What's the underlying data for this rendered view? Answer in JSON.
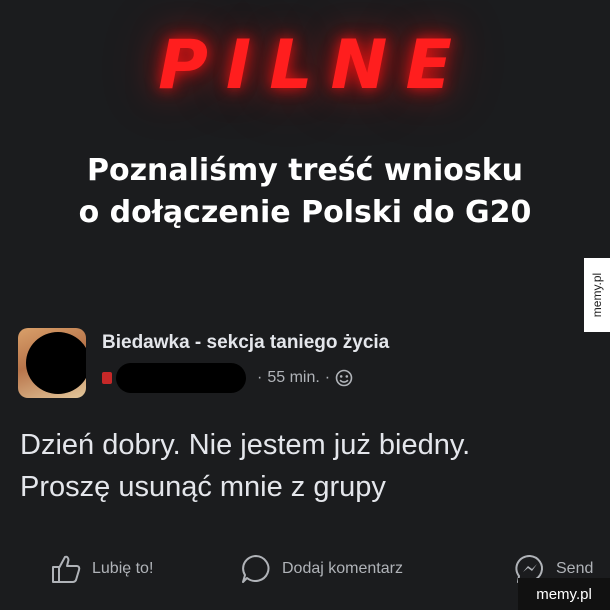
{
  "meme": {
    "headline": "PILNE",
    "subhead_lines": [
      "Poznaliśmy treść wniosku",
      "o dołączenie Polski do G20"
    ]
  },
  "post": {
    "group_name": "Biedawka - sekcja taniego życia",
    "time": "55 min.",
    "meta_icon": "globe-icon",
    "message_lines": [
      "Dzień dobry. Nie jestem już biedny.",
      "Proszę usunąć mnie z grupy"
    ]
  },
  "actions": {
    "like_label": "Lubię to!",
    "comment_label": "Dodaj komentarz",
    "send_label": "Send"
  },
  "watermarks": {
    "side": "memy.pl",
    "corner": "memy.pl"
  },
  "colors": {
    "headline_red": "#ff1e1e",
    "background": "#1b1c1e",
    "text_primary": "#e4e6eb",
    "text_secondary": "#b0b3b8"
  }
}
